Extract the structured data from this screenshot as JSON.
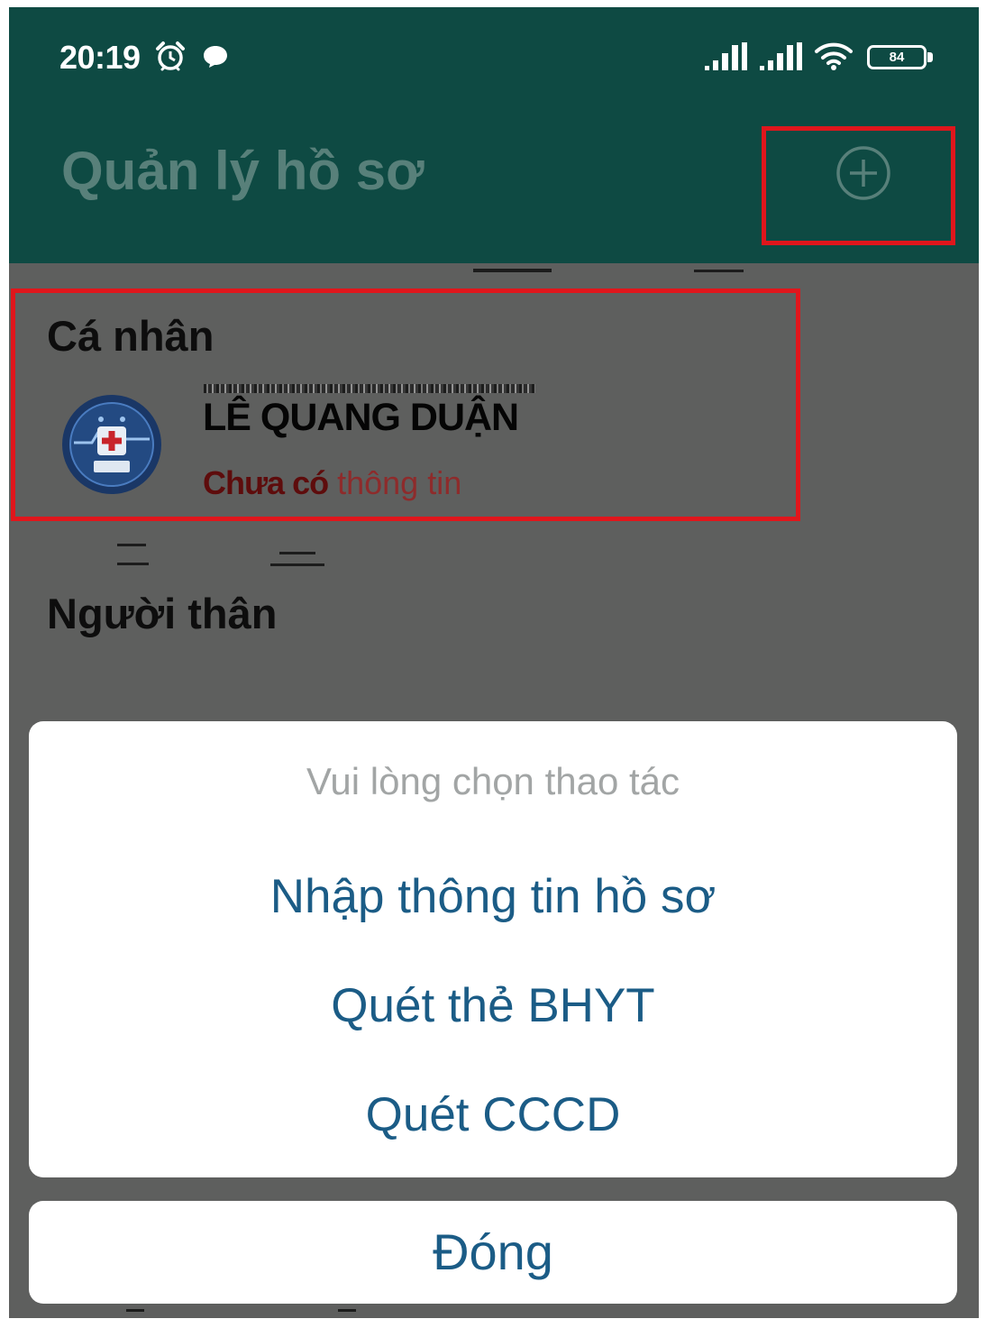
{
  "status_bar": {
    "time": "20:19",
    "battery_level": "84",
    "left_icons": [
      "alarm-icon",
      "chat-icon"
    ],
    "right_icons": [
      "signal-icon",
      "signal-icon",
      "wifi-icon",
      "battery-icon"
    ]
  },
  "header": {
    "title": "Quản lý hồ sơ",
    "action_icon": "plus-circle-icon"
  },
  "personal_section": {
    "heading": "Cá nhân",
    "profile": {
      "avatar_icon": "health-badge-icon",
      "name": "LÊ QUANG DUẬN",
      "status_strong": "Chưa có",
      "status_rest": "thông tin"
    }
  },
  "relatives_section": {
    "heading": "Người thân"
  },
  "action_sheet": {
    "title": "Vui lòng chọn thao tác",
    "options": [
      {
        "label": "Nhập thông tin hồ sơ"
      },
      {
        "label": "Quét thẻ BHYT"
      },
      {
        "label": "Quét CCCD"
      }
    ],
    "close_label": "Đóng"
  },
  "colors": {
    "header_bg": "#0e4a43",
    "overlay_bg": "#5e5f5e",
    "accent_blue": "#1b5c86",
    "annotation_red": "#e0161c",
    "faded_header_text": "#58807a",
    "status_red": "#5e0c0c",
    "status_red_light": "#8e2b2b",
    "sheet_title_gray": "#a2a5a5"
  }
}
